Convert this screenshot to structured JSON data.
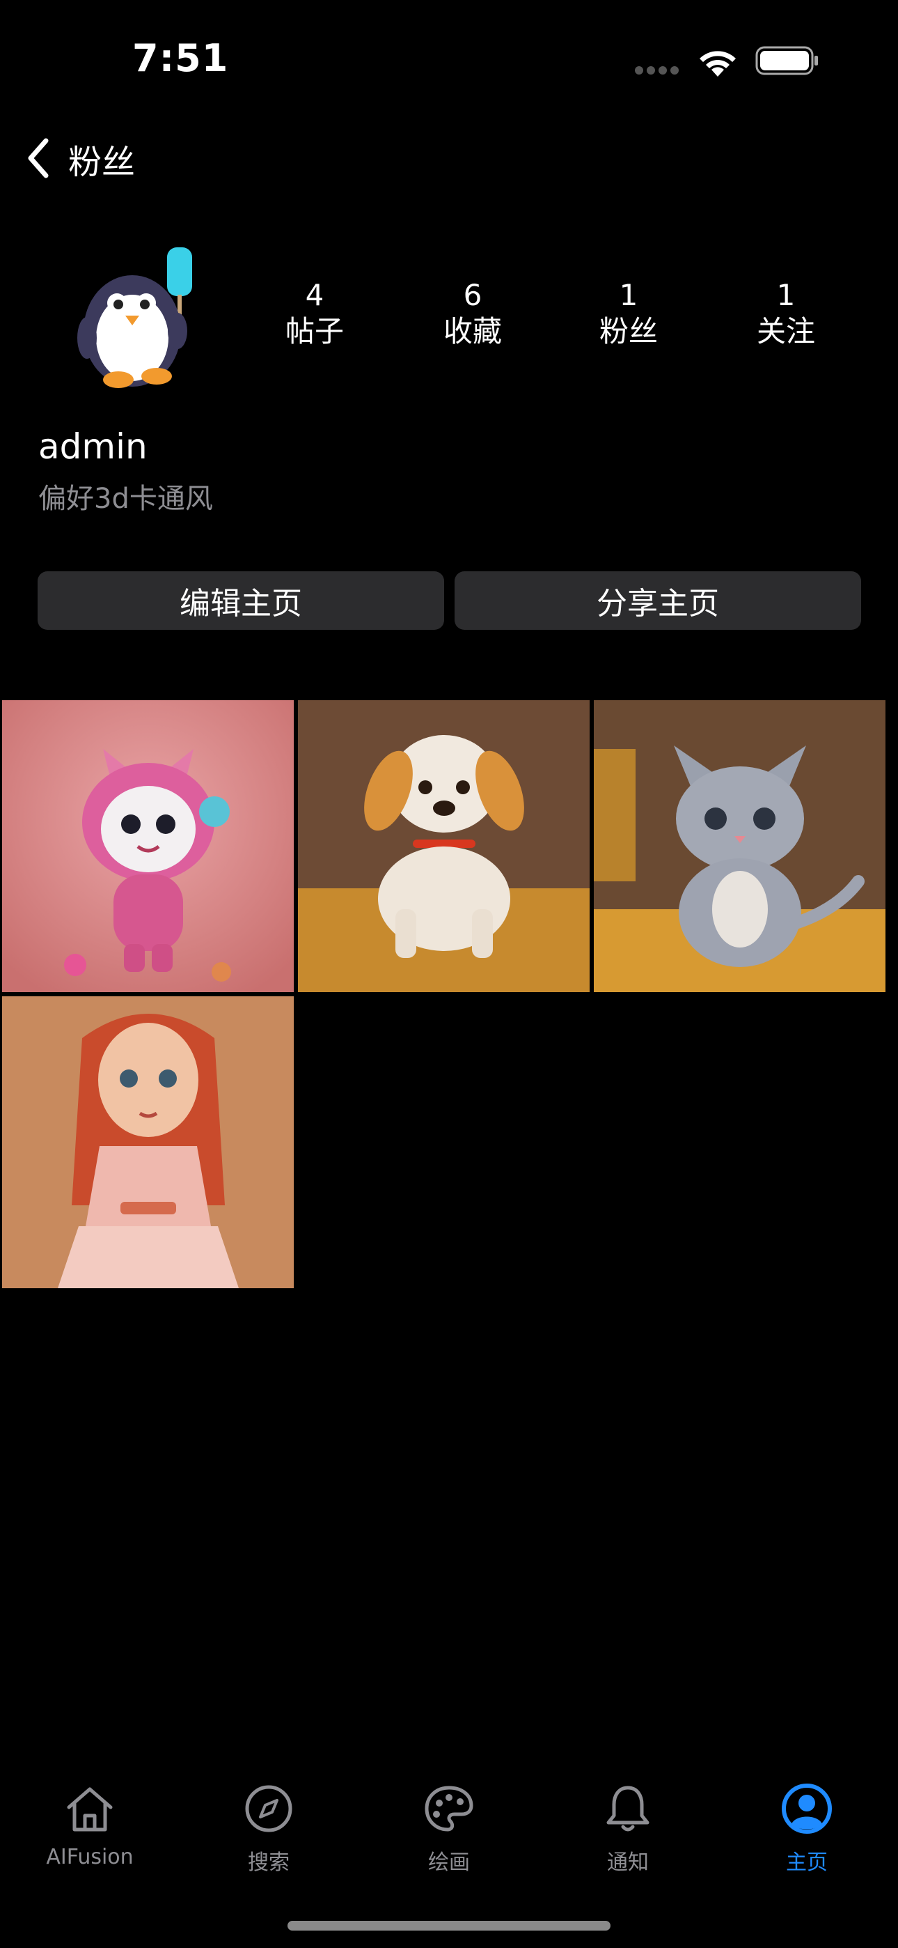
{
  "status_bar": {
    "time": "7:51"
  },
  "nav": {
    "title": "粉丝"
  },
  "profile": {
    "username": "admin",
    "bio": "偏好3d卡通风",
    "stats": [
      {
        "value": "4",
        "label": "帖子"
      },
      {
        "value": "6",
        "label": "收藏"
      },
      {
        "value": "1",
        "label": "粉丝"
      },
      {
        "value": "1",
        "label": "关注"
      }
    ]
  },
  "actions": {
    "edit_label": "编辑主页",
    "share_label": "分享主页"
  },
  "posts": [
    {
      "subject": "pink-bunny-character"
    },
    {
      "subject": "cartoon-puppy"
    },
    {
      "subject": "cartoon-kitten"
    },
    {
      "subject": "cartoon-girl"
    }
  ],
  "tabbar": {
    "items": [
      {
        "label": "AIFusion",
        "icon": "home-icon"
      },
      {
        "label": "搜索",
        "icon": "compass-icon"
      },
      {
        "label": "绘画",
        "icon": "palette-icon"
      },
      {
        "label": "通知",
        "icon": "bell-icon"
      },
      {
        "label": "主页",
        "icon": "person-circle-icon"
      }
    ],
    "active_index": 4,
    "active_color": "#1f8bff",
    "inactive_color": "#8e8e93"
  },
  "colors": {
    "background": "#000000",
    "button_bg": "#2c2c2e",
    "secondary_text": "#8e8e93"
  }
}
